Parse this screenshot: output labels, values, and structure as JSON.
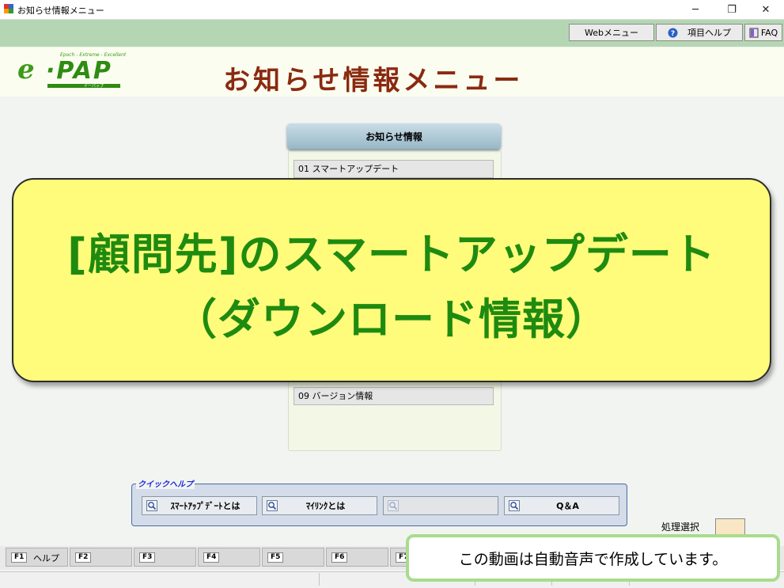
{
  "window": {
    "title": "お知らせ情報メニュー",
    "minimize_glyph": "─",
    "restore_glyph": "❐",
    "close_glyph": "✕"
  },
  "toolbar": {
    "web_menu": "Webメニュー",
    "item_help": "項目ヘルプ",
    "faq": "FAQ"
  },
  "logo": {
    "e": "e",
    "brand": "·PAP",
    "tagline": "Epoch - Extreme - Excellent",
    "kana": "イーパップ"
  },
  "page_title": "お知らせ情報メニュー",
  "panel": {
    "header": "お知らせ情報",
    "items": [
      {
        "label": "01  スマートアップデート"
      },
      {
        "label": "09  バージョン情報"
      }
    ]
  },
  "banner": {
    "line1": "[顧問先]のスマートアップデート",
    "line2": "（ダウンロード情報）"
  },
  "quick_help": {
    "legend": "クイックヘルプ",
    "buttons": [
      {
        "label": "ｽﾏｰﾄｱｯﾌﾟﾃﾞｰﾄとは"
      },
      {
        "label": "ﾏｲﾘﾝｸとは"
      },
      {
        "label": ""
      },
      {
        "label": "Q＆A"
      }
    ]
  },
  "process_select": {
    "label": "処理選択",
    "value": ""
  },
  "fkeys": [
    {
      "key": "F1",
      "label": "ヘルプ"
    },
    {
      "key": "F2",
      "label": ""
    },
    {
      "key": "F3",
      "label": ""
    },
    {
      "key": "F4",
      "label": ""
    },
    {
      "key": "F5",
      "label": ""
    },
    {
      "key": "F6",
      "label": ""
    },
    {
      "key": "F7",
      "label": ""
    }
  ],
  "caption": "この動画は自動音声で作成しています。",
  "colors": {
    "toolbar_green": "#b5d6b2",
    "title_brown": "#8a2a10",
    "banner_yellow": "#fefc7a",
    "banner_text_green": "#1f8a10",
    "caption_border": "#a8dc8c"
  }
}
